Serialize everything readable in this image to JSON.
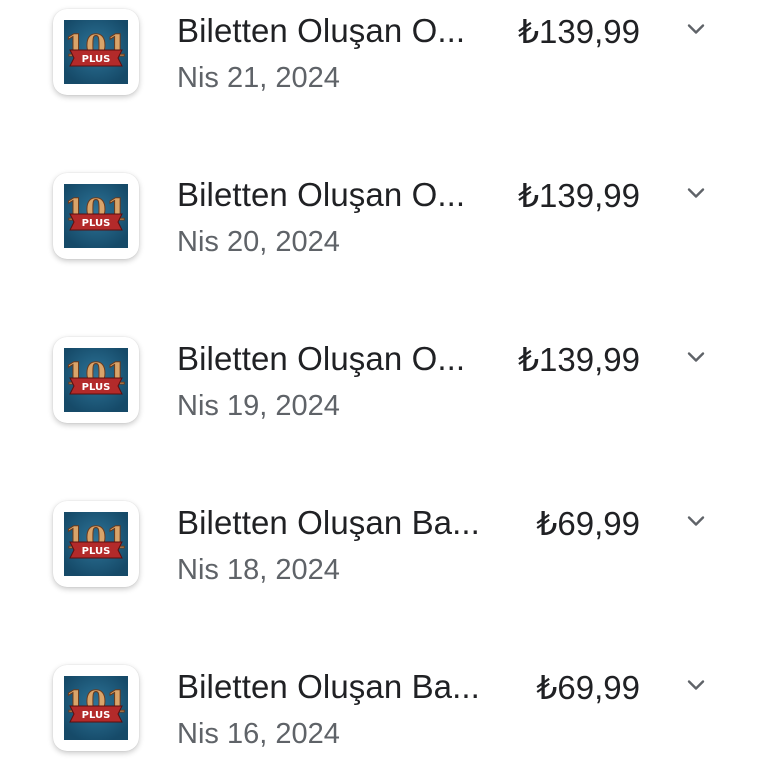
{
  "purchases": [
    {
      "title": "Biletten Oluşan O...",
      "price": "₺139,99",
      "date": "Nis 21, 2024",
      "app_icon": "101-okey-plus-icon",
      "expand_icon": "chevron-down-icon"
    },
    {
      "title": "Biletten Oluşan O...",
      "price": "₺139,99",
      "date": "Nis 20, 2024",
      "app_icon": "101-okey-plus-icon",
      "expand_icon": "chevron-down-icon"
    },
    {
      "title": "Biletten Oluşan O...",
      "price": "₺139,99",
      "date": "Nis 19, 2024",
      "app_icon": "101-okey-plus-icon",
      "expand_icon": "chevron-down-icon"
    },
    {
      "title": "Biletten Oluşan Ba...",
      "price": "₺69,99",
      "date": "Nis 18, 2024",
      "app_icon": "101-okey-plus-icon",
      "expand_icon": "chevron-down-icon"
    },
    {
      "title": "Biletten Oluşan Ba...",
      "price": "₺69,99",
      "date": "Nis 16, 2024",
      "app_icon": "101-okey-plus-icon",
      "expand_icon": "chevron-down-icon"
    }
  ],
  "colors": {
    "icon_background": "#1c5a7c",
    "icon_banner": "#b32a2a",
    "icon_numerals": "#d9a46a",
    "title_text": "#202124",
    "date_text": "#5f6368",
    "chevron": "#5f6368"
  },
  "logo_text": "PLUS"
}
